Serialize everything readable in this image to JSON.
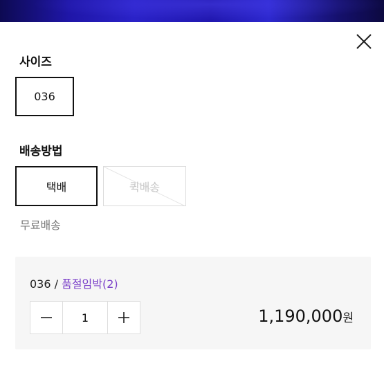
{
  "close": {
    "icon": "close-icon"
  },
  "size": {
    "title": "사이즈",
    "options": [
      {
        "label": "036",
        "selected": true
      }
    ]
  },
  "shipping": {
    "title": "배송방법",
    "options": [
      {
        "label": "택배",
        "selected": true,
        "available": true
      },
      {
        "label": "퀵배송",
        "selected": false,
        "available": false
      }
    ],
    "note": "무료배송"
  },
  "order": {
    "option": "036",
    "separator": " / ",
    "stock_status": "품절임박(2)",
    "quantity": "1",
    "price": "1,190,000",
    "currency": "원"
  },
  "colors": {
    "stock_status": "#7a3fc9",
    "selected_border": "#111111",
    "disabled_text": "#c8c8c8"
  }
}
